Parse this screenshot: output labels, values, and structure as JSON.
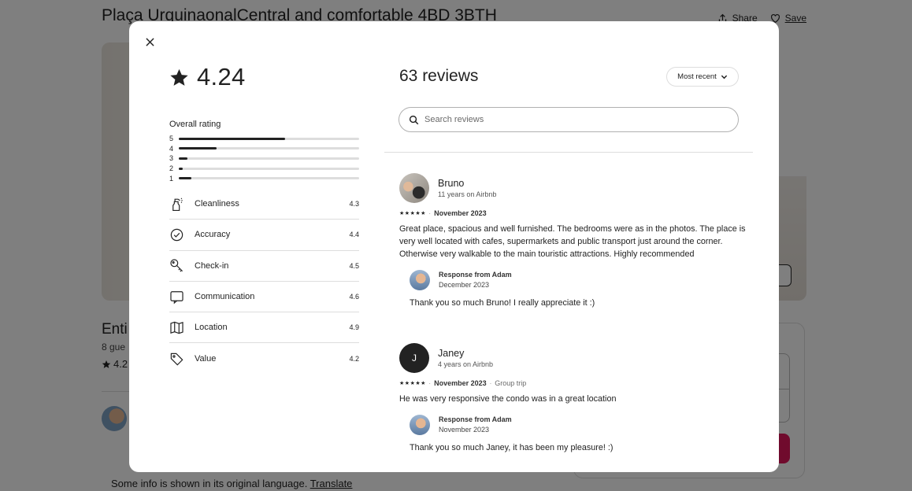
{
  "background": {
    "listing_title": "Plaça UrquinaonalCentral and comfortable 4BD 3BTH",
    "share_label": "Share",
    "save_label": "Save",
    "entire_heading": "Enti",
    "guests_text": "8 gue",
    "rating_text": "4.2",
    "info_text": "Some info is shown in its original language.",
    "translate_label": "Translate"
  },
  "modal": {
    "overall_rating": "4.24",
    "overall_label": "Overall rating",
    "rating_distribution": [
      {
        "stars": "5",
        "fraction": 0.59
      },
      {
        "stars": "4",
        "fraction": 0.21
      },
      {
        "stars": "3",
        "fraction": 0.05
      },
      {
        "stars": "2",
        "fraction": 0.02
      },
      {
        "stars": "1",
        "fraction": 0.07
      }
    ],
    "categories": [
      {
        "label": "Cleanliness",
        "value": "4.3",
        "icon": "spray-bottle-icon"
      },
      {
        "label": "Accuracy",
        "value": "4.4",
        "icon": "check-circle-icon"
      },
      {
        "label": "Check-in",
        "value": "4.5",
        "icon": "key-icon"
      },
      {
        "label": "Communication",
        "value": "4.6",
        "icon": "chat-bubble-icon"
      },
      {
        "label": "Location",
        "value": "4.9",
        "icon": "map-icon"
      },
      {
        "label": "Value",
        "value": "4.2",
        "icon": "tag-icon"
      }
    ],
    "reviews_header": "63 reviews",
    "sort_label": "Most recent",
    "search_placeholder": "Search reviews",
    "reviews": [
      {
        "name": "Bruno",
        "tenure": "11 years on Airbnb",
        "date": "November 2023",
        "trip_type": "",
        "rating": 5,
        "text": "Great place, spacious and well furnished. The bedrooms were as in the photos. The place is very well located with cafes, supermarkets and public transport just around the corner. Otherwise very walkable to the main touristic attractions. Highly recommended",
        "response": {
          "from": "Response from Adam",
          "date": "December 2023",
          "text": "Thank you so much Bruno! I really appreciate it :)"
        }
      },
      {
        "name": "Janey",
        "initial": "J",
        "tenure": "4 years on Airbnb",
        "date": "November 2023",
        "trip_type": "Group trip",
        "rating": 5,
        "text": "He was very responsive the condo was in a great location",
        "response": {
          "from": "Response from Adam",
          "date": "November 2023",
          "text": "Thank you so much Janey, it has been my pleasure! :)"
        }
      }
    ]
  }
}
